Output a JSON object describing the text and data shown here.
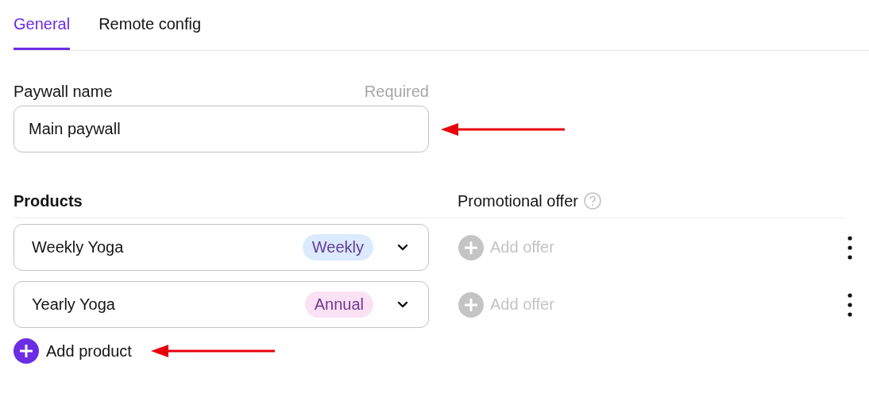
{
  "tabs": [
    {
      "label": "General",
      "selected": true
    },
    {
      "label": "Remote config",
      "selected": false
    }
  ],
  "paywall_name": {
    "label": "Paywall name",
    "hint": "Required",
    "value": "Main paywall"
  },
  "products": {
    "heading": "Products",
    "offer_heading": "Promotional offer",
    "rows": [
      {
        "name": "Weekly Yoga",
        "tag": "Weekly",
        "color": "#dbeafe",
        "offer": "Add offer",
        "offer_disabled": true
      },
      {
        "name": "Yearly Yoga",
        "tag": "Annual",
        "color": "#fbe1f4",
        "offer": "Add offer",
        "offer_disabled": true
      }
    ],
    "add_label": "Add product"
  }
}
